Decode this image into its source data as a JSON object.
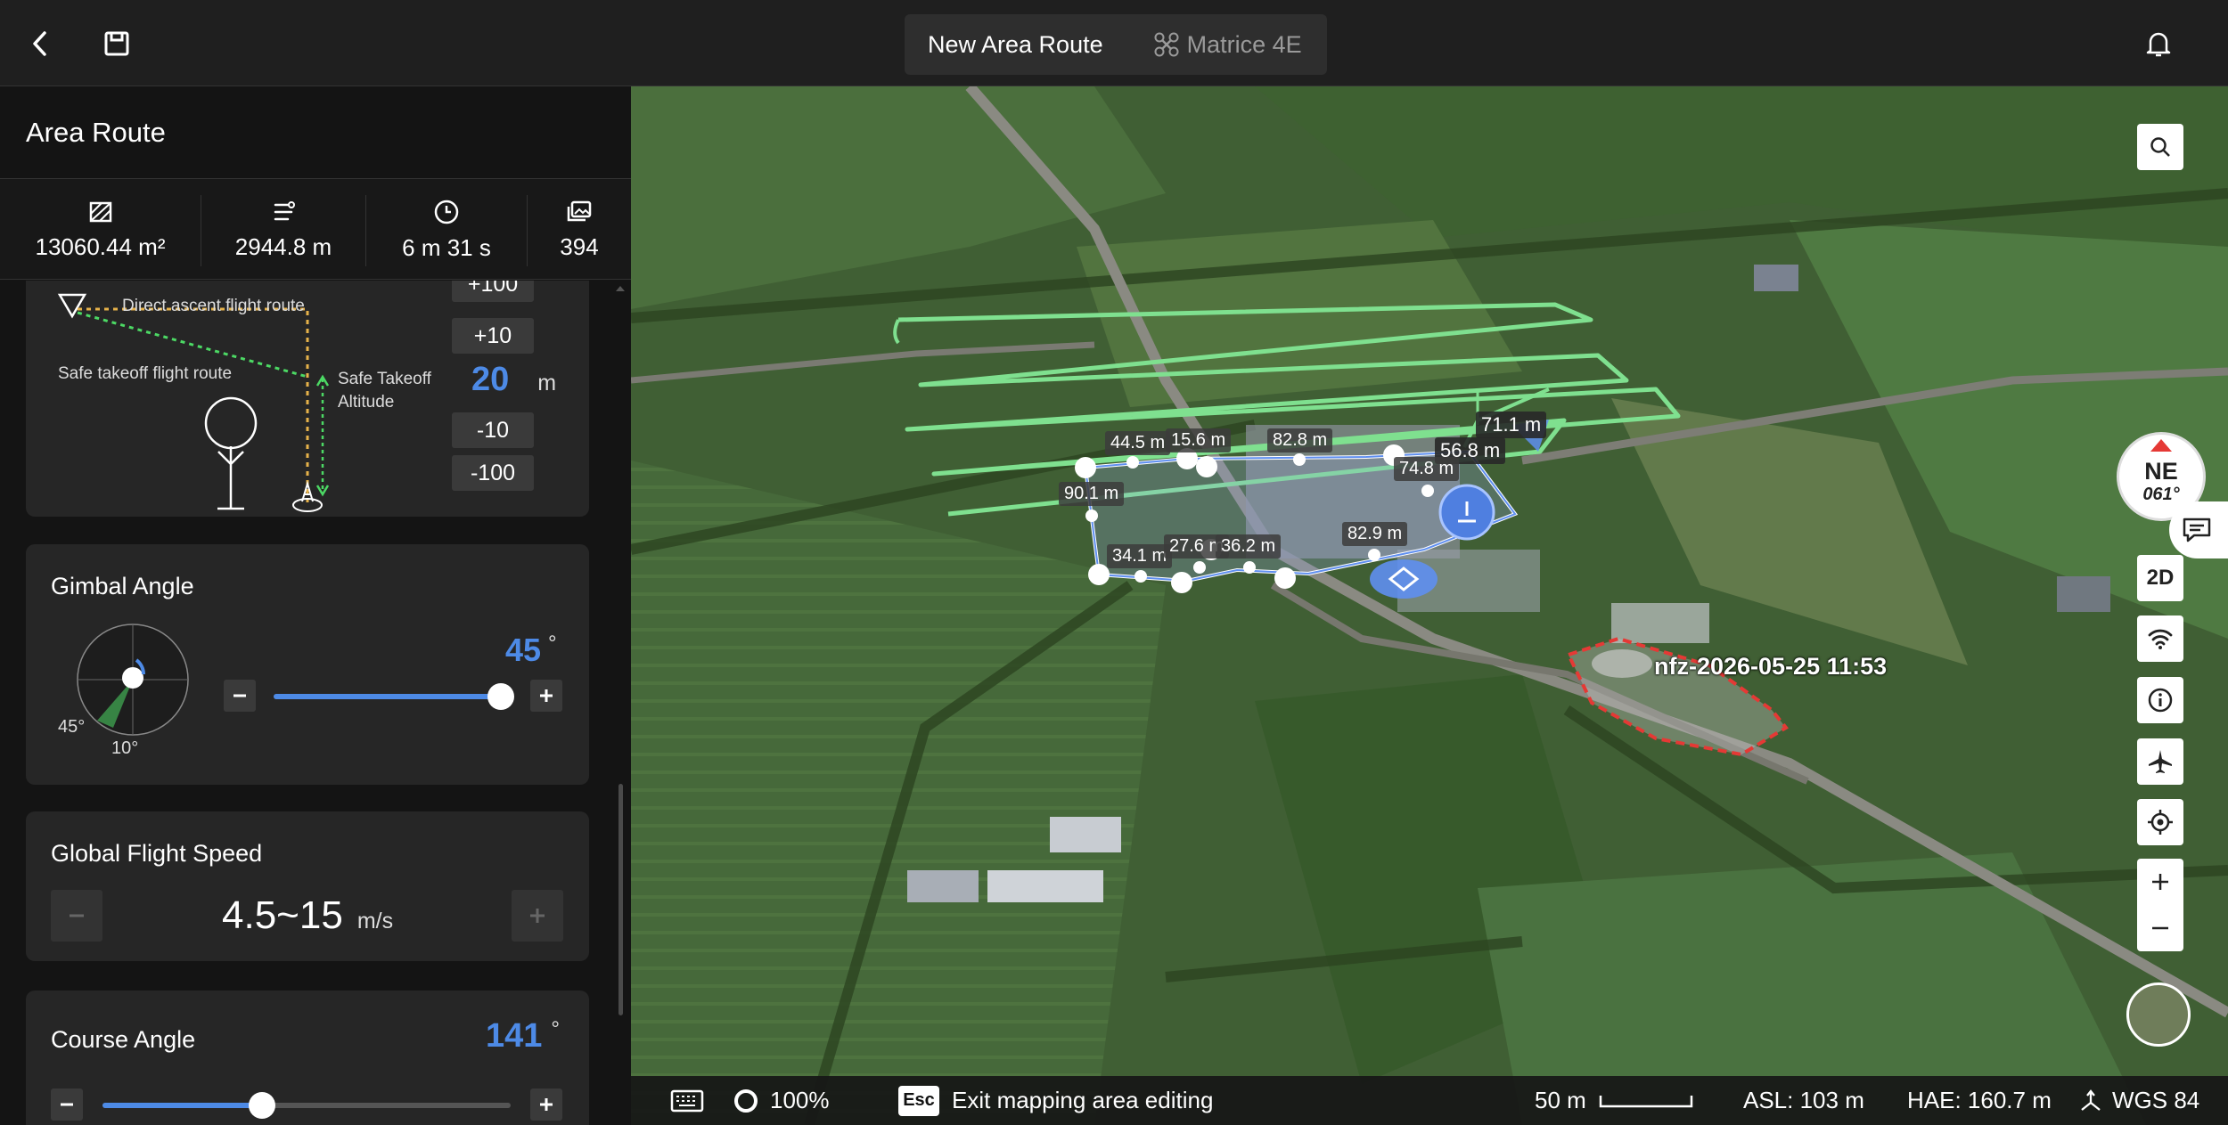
{
  "topbar": {
    "title": "New Area Route",
    "device": "Matrice 4E"
  },
  "panel": {
    "title": "Area Route",
    "stats": [
      {
        "icon": "area-icon",
        "value": "13060.44 m²"
      },
      {
        "icon": "route-length-icon",
        "value": "2944.8 m"
      },
      {
        "icon": "clock-icon",
        "value": "6 m 31 s"
      },
      {
        "icon": "photos-icon",
        "value": "394"
      }
    ],
    "takeoff": {
      "direct_label": "Direct ascent flight route",
      "safe_route_label": "Safe takeoff flight route",
      "safe_alt_label_1": "Safe Takeoff",
      "safe_alt_label_2": "Altitude",
      "buttons": [
        "+100",
        "+10",
        "-10",
        "-100"
      ],
      "value": "20",
      "unit": "m"
    },
    "gimbal": {
      "title": "Gimbal Angle",
      "value": "45",
      "unit": "°",
      "label_a": "45°",
      "label_b": "10°",
      "level": 0.95
    },
    "speed": {
      "title": "Global Flight Speed",
      "value": "4.5~15",
      "unit": "m/s"
    },
    "course": {
      "title": "Course Angle",
      "value": "141",
      "unit": "°",
      "level": 0.39
    }
  },
  "map": {
    "distance_labels": [
      "44.5 m",
      "15.6 m",
      "82.8 m",
      "71.1 m",
      "56.8 m",
      "74.8 m",
      "90.1 m",
      "34.1 m",
      "27.6 m",
      "36.2 m",
      "82.9 m"
    ],
    "nfz_label": "nfz-2026-05-25 11:53",
    "compass": {
      "dir": "NE",
      "deg": "061°"
    },
    "view_mode": "2D",
    "colors": {
      "route": "#7fe08f",
      "boundary": "#5f8ff0",
      "nfz": "#e53935",
      "accent": "#4d8ae6"
    }
  },
  "status": {
    "progress": "100%",
    "esc_key": "Esc",
    "esc_text": "Exit mapping area editing",
    "scale": "50 m",
    "asl": "ASL: 103 m",
    "hae": "HAE: 160.7 m",
    "datum": "WGS 84"
  }
}
